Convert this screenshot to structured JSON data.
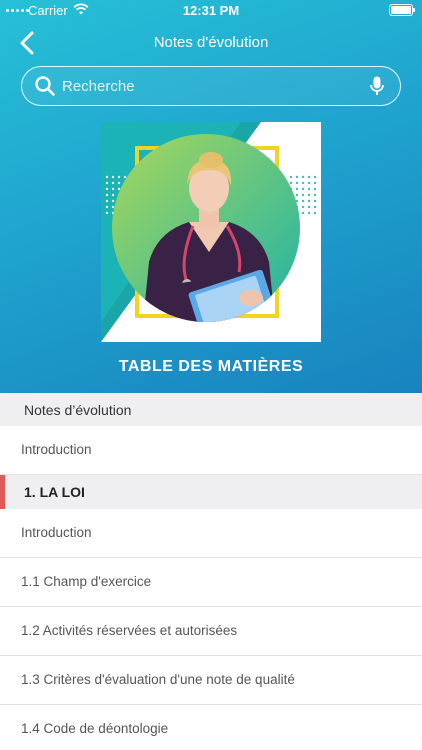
{
  "status_bar": {
    "carrier": "Carrier",
    "time": "12:31 PM"
  },
  "nav": {
    "title": "Notes d'évolution",
    "back_icon": "chevron-left-icon"
  },
  "search": {
    "placeholder": "Recherche"
  },
  "cover": {
    "image": "nurse-with-clipboard"
  },
  "toc": {
    "title": "TABLE DES MATIÈRES"
  },
  "sections": [
    {
      "header": "Notes d’évolution",
      "items": [
        "Introduction"
      ]
    },
    {
      "header": "1. LA LOI",
      "active": true,
      "items": [
        "Introduction",
        "1.1 Champ d'exercice",
        "1.2 Activités réservées et autorisées",
        "1.3 Critères d'évaluation d'une note de qualité",
        "1.4 Code de déontologie"
      ]
    }
  ],
  "colors": {
    "gradient_start": "#27c0d6",
    "gradient_end": "#1883bf",
    "active_marker": "#e05a57"
  }
}
